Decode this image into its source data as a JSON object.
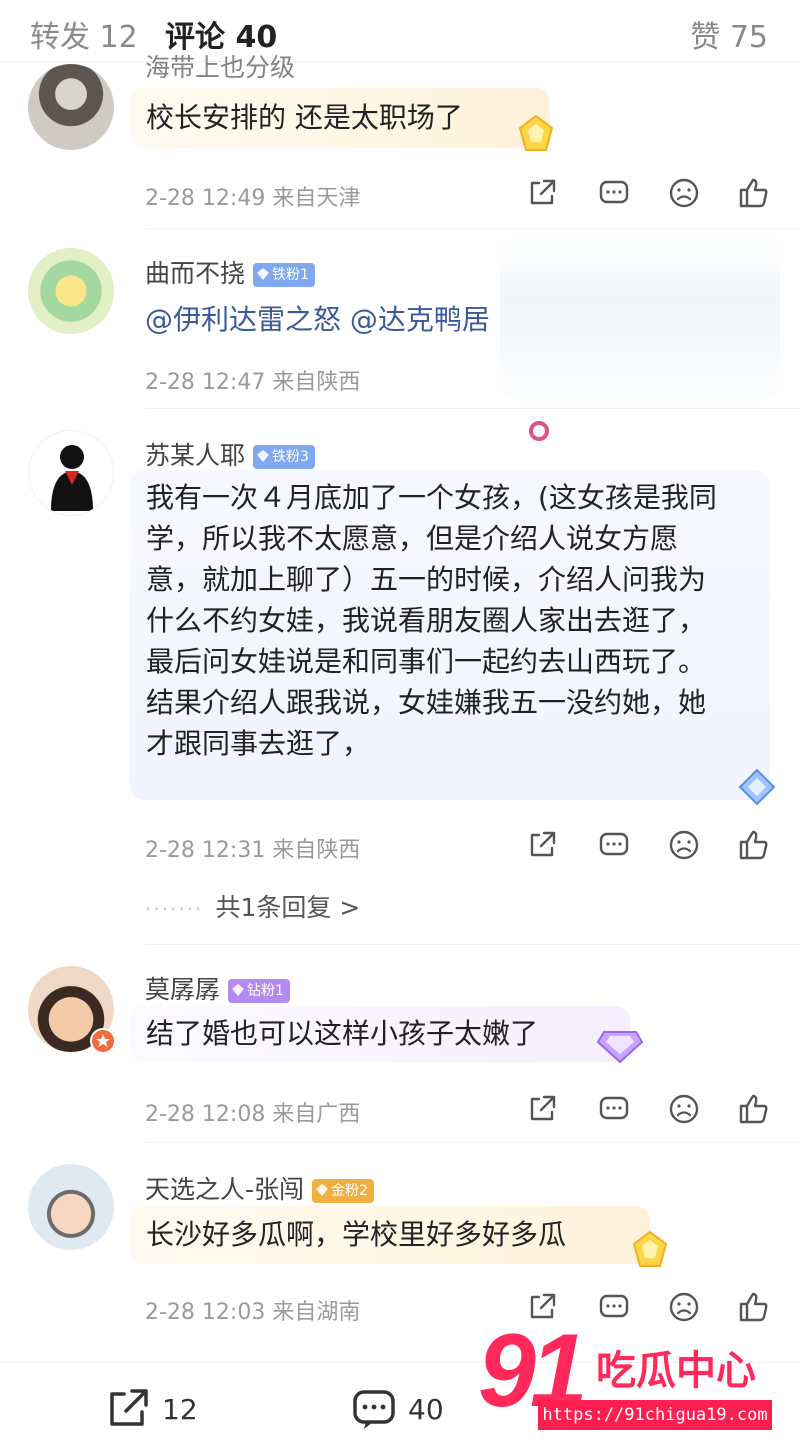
{
  "tabs": {
    "reposts": "转发 12",
    "comments": "评论 40",
    "likes": "赞 75"
  },
  "comments": [
    {
      "username": "海带上也分级",
      "text": "校长安排的 还是太职场了",
      "time": "2-28 12:49 来自天津"
    },
    {
      "username": "曲而不挠",
      "badge": "铁粉1",
      "text": "@伊利达雷之怒 @达克鸭居",
      "time": "2-28 12:47 来自陕西"
    },
    {
      "username": "苏某人耶",
      "badge": "铁粉3",
      "text_lines": [
        "我有一次４月底加了一个女孩，(这女孩是我同",
        "学，所以我不太愿意，但是介绍人说女方愿",
        "意，就加上聊了）五一的时候，介绍人问我为",
        "什么不约女娃，我说看朋友圈人家出去逛了，",
        "最后问女娃说是和同事们一起约去山西玩了。",
        "结果介绍人跟我说，女娃嫌我五一没约她，她",
        "才跟同事去逛了，"
      ],
      "time": "2-28 12:31 来自陕西",
      "replies_link": "共1条回复 >"
    },
    {
      "username": "莫孱孱",
      "badge": "钻粉1",
      "text": "结了婚也可以这样小孩子太嫩了",
      "time": "2-28 12:08 来自广西"
    },
    {
      "username": "天选之人-张闯",
      "badge": "金粉2",
      "text": "长沙好多瓜啊，学校里好多好多瓜",
      "time": "2-28 12:03 来自湖南"
    }
  ],
  "bottom_bar": {
    "share_count": "12",
    "comment_count": "40"
  },
  "watermark": {
    "number": "91",
    "text": "吃瓜中心",
    "url": "https://91chigua19.com"
  },
  "colors": {
    "iron_badge": "#7fa8f0",
    "diamond_badge": "#b48af0",
    "gold_badge": "#f0b040",
    "watermark": "#ff2a5a"
  },
  "icons": [
    "share-icon",
    "reply-icon",
    "dislike-icon",
    "like-icon",
    "more-chat-icon"
  ]
}
